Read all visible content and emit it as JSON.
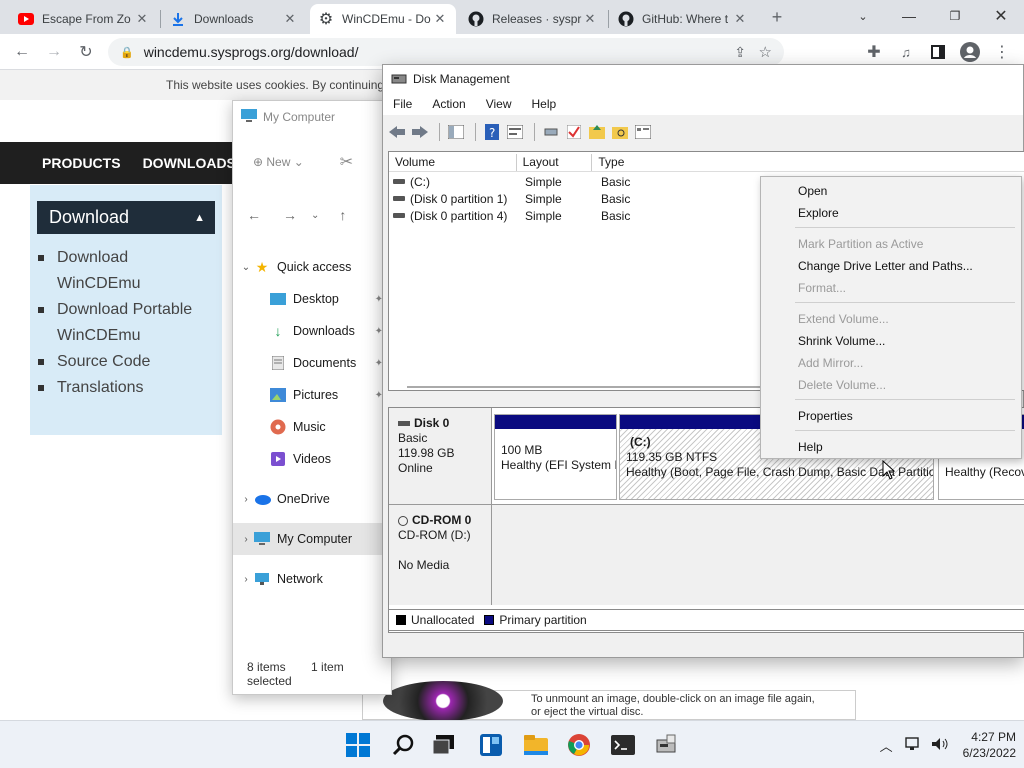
{
  "browser": {
    "tabs": [
      {
        "title": "Escape From Zo",
        "icon": "youtube-icon"
      },
      {
        "title": "Downloads",
        "icon": "download-icon"
      },
      {
        "title": "WinCDEmu - Do",
        "icon": "gear-icon"
      },
      {
        "title": "Releases · syspr",
        "icon": "github-icon"
      },
      {
        "title": "GitHub: Where t",
        "icon": "github-icon"
      }
    ],
    "url": "wincdemu.sysprogs.org/download/"
  },
  "website": {
    "cookie_text": "This website uses cookies. By continuing to",
    "nav": [
      "PRODUCTS",
      "DOWNLOADS"
    ],
    "download_heading": "Download",
    "download_links": [
      "Download",
      "WinCDEmu",
      "Download Portable",
      "WinCDEmu",
      "Source Code",
      "Translations"
    ],
    "bottom_text_1": "To unmount an image, double-click on an image file again,",
    "bottom_text_2": "or eject the virtual disc."
  },
  "explorer": {
    "title": "My Computer",
    "new_label": "New",
    "nav_items": [
      {
        "label": "Quick access",
        "icon": "star-icon"
      },
      {
        "label": "Desktop",
        "icon": "desktop-icon"
      },
      {
        "label": "Downloads",
        "icon": "download-arrow-icon"
      },
      {
        "label": "Documents",
        "icon": "document-icon"
      },
      {
        "label": "Pictures",
        "icon": "pictures-icon"
      },
      {
        "label": "Music",
        "icon": "music-icon"
      },
      {
        "label": "Videos",
        "icon": "videos-icon"
      },
      {
        "label": "OneDrive",
        "icon": "cloud-icon"
      },
      {
        "label": "My Computer",
        "icon": "computer-icon"
      },
      {
        "label": "Network",
        "icon": "network-icon"
      }
    ],
    "status_items": "8 items",
    "status_selected": "1 item selected"
  },
  "disk_management": {
    "title": "Disk Management",
    "menu": [
      "File",
      "Action",
      "View",
      "Help"
    ],
    "columns": [
      "Volume",
      "Layout",
      "Type"
    ],
    "volumes": [
      {
        "volume": "(C:)",
        "layout": "Simple",
        "type": "Basic"
      },
      {
        "volume": "(Disk 0 partition 1)",
        "layout": "Simple",
        "type": "Basic"
      },
      {
        "volume": "(Disk 0 partition 4)",
        "layout": "Simple",
        "type": "Basic"
      }
    ],
    "disk0": {
      "name": "Disk 0",
      "type": "Basic",
      "size": "119.98 GB",
      "status": "Online"
    },
    "partitions": [
      {
        "name": "",
        "size": "100 MB",
        "status": "Healthy (EFI System I"
      },
      {
        "name": "(C:)",
        "size": "119.35 GB NTFS",
        "status": "Healthy (Boot, Page File, Crash Dump, Basic Data Partition"
      },
      {
        "name": "",
        "size": "",
        "status": "Healthy (Recov"
      }
    ],
    "cdrom": {
      "name": "CD-ROM 0",
      "drive": "CD-ROM (D:)",
      "status": "No Media"
    },
    "legend": [
      "Unallocated",
      "Primary partition"
    ],
    "colors": {
      "unallocated": "#000000",
      "primary": "#0a0a80"
    }
  },
  "context_menu": {
    "items": [
      {
        "label": "Open",
        "enabled": true
      },
      {
        "label": "Explore",
        "enabled": true
      },
      {
        "label": "Mark Partition as Active",
        "enabled": false
      },
      {
        "label": "Change Drive Letter and Paths...",
        "enabled": true
      },
      {
        "label": "Format...",
        "enabled": false
      },
      {
        "label": "Extend Volume...",
        "enabled": false
      },
      {
        "label": "Shrink Volume...",
        "enabled": true
      },
      {
        "label": "Add Mirror...",
        "enabled": false
      },
      {
        "label": "Delete Volume...",
        "enabled": false
      },
      {
        "label": "Properties",
        "enabled": true
      },
      {
        "label": "Help",
        "enabled": true
      }
    ]
  },
  "taskbar": {
    "time": "4:27 PM",
    "date": "6/23/2022"
  }
}
